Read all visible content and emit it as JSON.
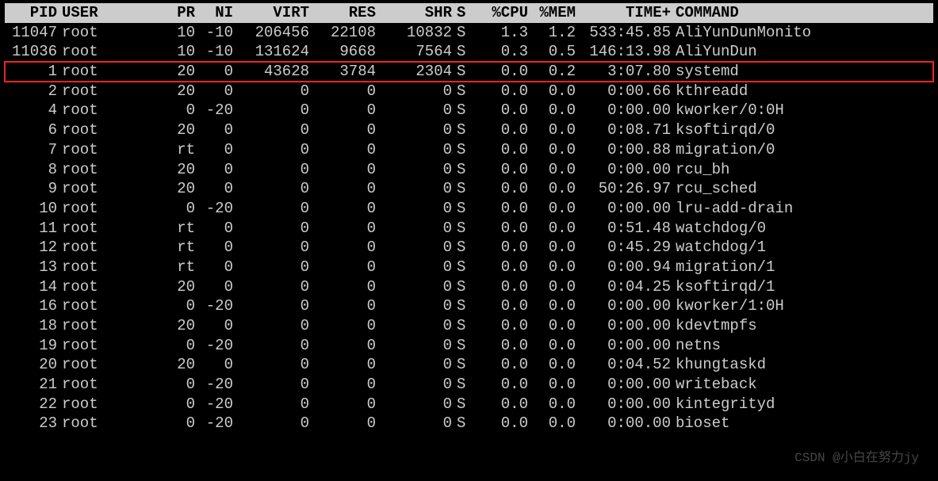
{
  "headers": {
    "pid": "PID",
    "user": "USER",
    "pr": "PR",
    "ni": "NI",
    "virt": "VIRT",
    "res": "RES",
    "shr": "SHR",
    "s": "S",
    "cpu": "%CPU",
    "mem": "%MEM",
    "time": "TIME+",
    "cmd": "COMMAND"
  },
  "highlight_index": 2,
  "rows": [
    {
      "pid": "11047",
      "user": "root",
      "pr": "10",
      "ni": "-10",
      "virt": "206456",
      "res": "22108",
      "shr": "10832",
      "s": "S",
      "cpu": "1.3",
      "mem": "1.2",
      "time": "533:45.85",
      "cmd": "AliYunDunMonito"
    },
    {
      "pid": "11036",
      "user": "root",
      "pr": "10",
      "ni": "-10",
      "virt": "131624",
      "res": "9668",
      "shr": "7564",
      "s": "S",
      "cpu": "0.3",
      "mem": "0.5",
      "time": "146:13.98",
      "cmd": "AliYunDun"
    },
    {
      "pid": "1",
      "user": "root",
      "pr": "20",
      "ni": "0",
      "virt": "43628",
      "res": "3784",
      "shr": "2304",
      "s": "S",
      "cpu": "0.0",
      "mem": "0.2",
      "time": "3:07.80",
      "cmd": "systemd"
    },
    {
      "pid": "2",
      "user": "root",
      "pr": "20",
      "ni": "0",
      "virt": "0",
      "res": "0",
      "shr": "0",
      "s": "S",
      "cpu": "0.0",
      "mem": "0.0",
      "time": "0:00.66",
      "cmd": "kthreadd"
    },
    {
      "pid": "4",
      "user": "root",
      "pr": "0",
      "ni": "-20",
      "virt": "0",
      "res": "0",
      "shr": "0",
      "s": "S",
      "cpu": "0.0",
      "mem": "0.0",
      "time": "0:00.00",
      "cmd": "kworker/0:0H"
    },
    {
      "pid": "6",
      "user": "root",
      "pr": "20",
      "ni": "0",
      "virt": "0",
      "res": "0",
      "shr": "0",
      "s": "S",
      "cpu": "0.0",
      "mem": "0.0",
      "time": "0:08.71",
      "cmd": "ksoftirqd/0"
    },
    {
      "pid": "7",
      "user": "root",
      "pr": "rt",
      "ni": "0",
      "virt": "0",
      "res": "0",
      "shr": "0",
      "s": "S",
      "cpu": "0.0",
      "mem": "0.0",
      "time": "0:00.88",
      "cmd": "migration/0"
    },
    {
      "pid": "8",
      "user": "root",
      "pr": "20",
      "ni": "0",
      "virt": "0",
      "res": "0",
      "shr": "0",
      "s": "S",
      "cpu": "0.0",
      "mem": "0.0",
      "time": "0:00.00",
      "cmd": "rcu_bh"
    },
    {
      "pid": "9",
      "user": "root",
      "pr": "20",
      "ni": "0",
      "virt": "0",
      "res": "0",
      "shr": "0",
      "s": "S",
      "cpu": "0.0",
      "mem": "0.0",
      "time": "50:26.97",
      "cmd": "rcu_sched"
    },
    {
      "pid": "10",
      "user": "root",
      "pr": "0",
      "ni": "-20",
      "virt": "0",
      "res": "0",
      "shr": "0",
      "s": "S",
      "cpu": "0.0",
      "mem": "0.0",
      "time": "0:00.00",
      "cmd": "lru-add-drain"
    },
    {
      "pid": "11",
      "user": "root",
      "pr": "rt",
      "ni": "0",
      "virt": "0",
      "res": "0",
      "shr": "0",
      "s": "S",
      "cpu": "0.0",
      "mem": "0.0",
      "time": "0:51.48",
      "cmd": "watchdog/0"
    },
    {
      "pid": "12",
      "user": "root",
      "pr": "rt",
      "ni": "0",
      "virt": "0",
      "res": "0",
      "shr": "0",
      "s": "S",
      "cpu": "0.0",
      "mem": "0.0",
      "time": "0:45.29",
      "cmd": "watchdog/1"
    },
    {
      "pid": "13",
      "user": "root",
      "pr": "rt",
      "ni": "0",
      "virt": "0",
      "res": "0",
      "shr": "0",
      "s": "S",
      "cpu": "0.0",
      "mem": "0.0",
      "time": "0:00.94",
      "cmd": "migration/1"
    },
    {
      "pid": "14",
      "user": "root",
      "pr": "20",
      "ni": "0",
      "virt": "0",
      "res": "0",
      "shr": "0",
      "s": "S",
      "cpu": "0.0",
      "mem": "0.0",
      "time": "0:04.25",
      "cmd": "ksoftirqd/1"
    },
    {
      "pid": "16",
      "user": "root",
      "pr": "0",
      "ni": "-20",
      "virt": "0",
      "res": "0",
      "shr": "0",
      "s": "S",
      "cpu": "0.0",
      "mem": "0.0",
      "time": "0:00.00",
      "cmd": "kworker/1:0H"
    },
    {
      "pid": "18",
      "user": "root",
      "pr": "20",
      "ni": "0",
      "virt": "0",
      "res": "0",
      "shr": "0",
      "s": "S",
      "cpu": "0.0",
      "mem": "0.0",
      "time": "0:00.00",
      "cmd": "kdevtmpfs"
    },
    {
      "pid": "19",
      "user": "root",
      "pr": "0",
      "ni": "-20",
      "virt": "0",
      "res": "0",
      "shr": "0",
      "s": "S",
      "cpu": "0.0",
      "mem": "0.0",
      "time": "0:00.00",
      "cmd": "netns"
    },
    {
      "pid": "20",
      "user": "root",
      "pr": "20",
      "ni": "0",
      "virt": "0",
      "res": "0",
      "shr": "0",
      "s": "S",
      "cpu": "0.0",
      "mem": "0.0",
      "time": "0:04.52",
      "cmd": "khungtaskd"
    },
    {
      "pid": "21",
      "user": "root",
      "pr": "0",
      "ni": "-20",
      "virt": "0",
      "res": "0",
      "shr": "0",
      "s": "S",
      "cpu": "0.0",
      "mem": "0.0",
      "time": "0:00.00",
      "cmd": "writeback"
    },
    {
      "pid": "22",
      "user": "root",
      "pr": "0",
      "ni": "-20",
      "virt": "0",
      "res": "0",
      "shr": "0",
      "s": "S",
      "cpu": "0.0",
      "mem": "0.0",
      "time": "0:00.00",
      "cmd": "kintegrityd"
    },
    {
      "pid": "23",
      "user": "root",
      "pr": "0",
      "ni": "-20",
      "virt": "0",
      "res": "0",
      "shr": "0",
      "s": "S",
      "cpu": "0.0",
      "mem": "0.0",
      "time": "0:00.00",
      "cmd": "bioset"
    }
  ],
  "watermark": "CSDN @小白在努力jy"
}
